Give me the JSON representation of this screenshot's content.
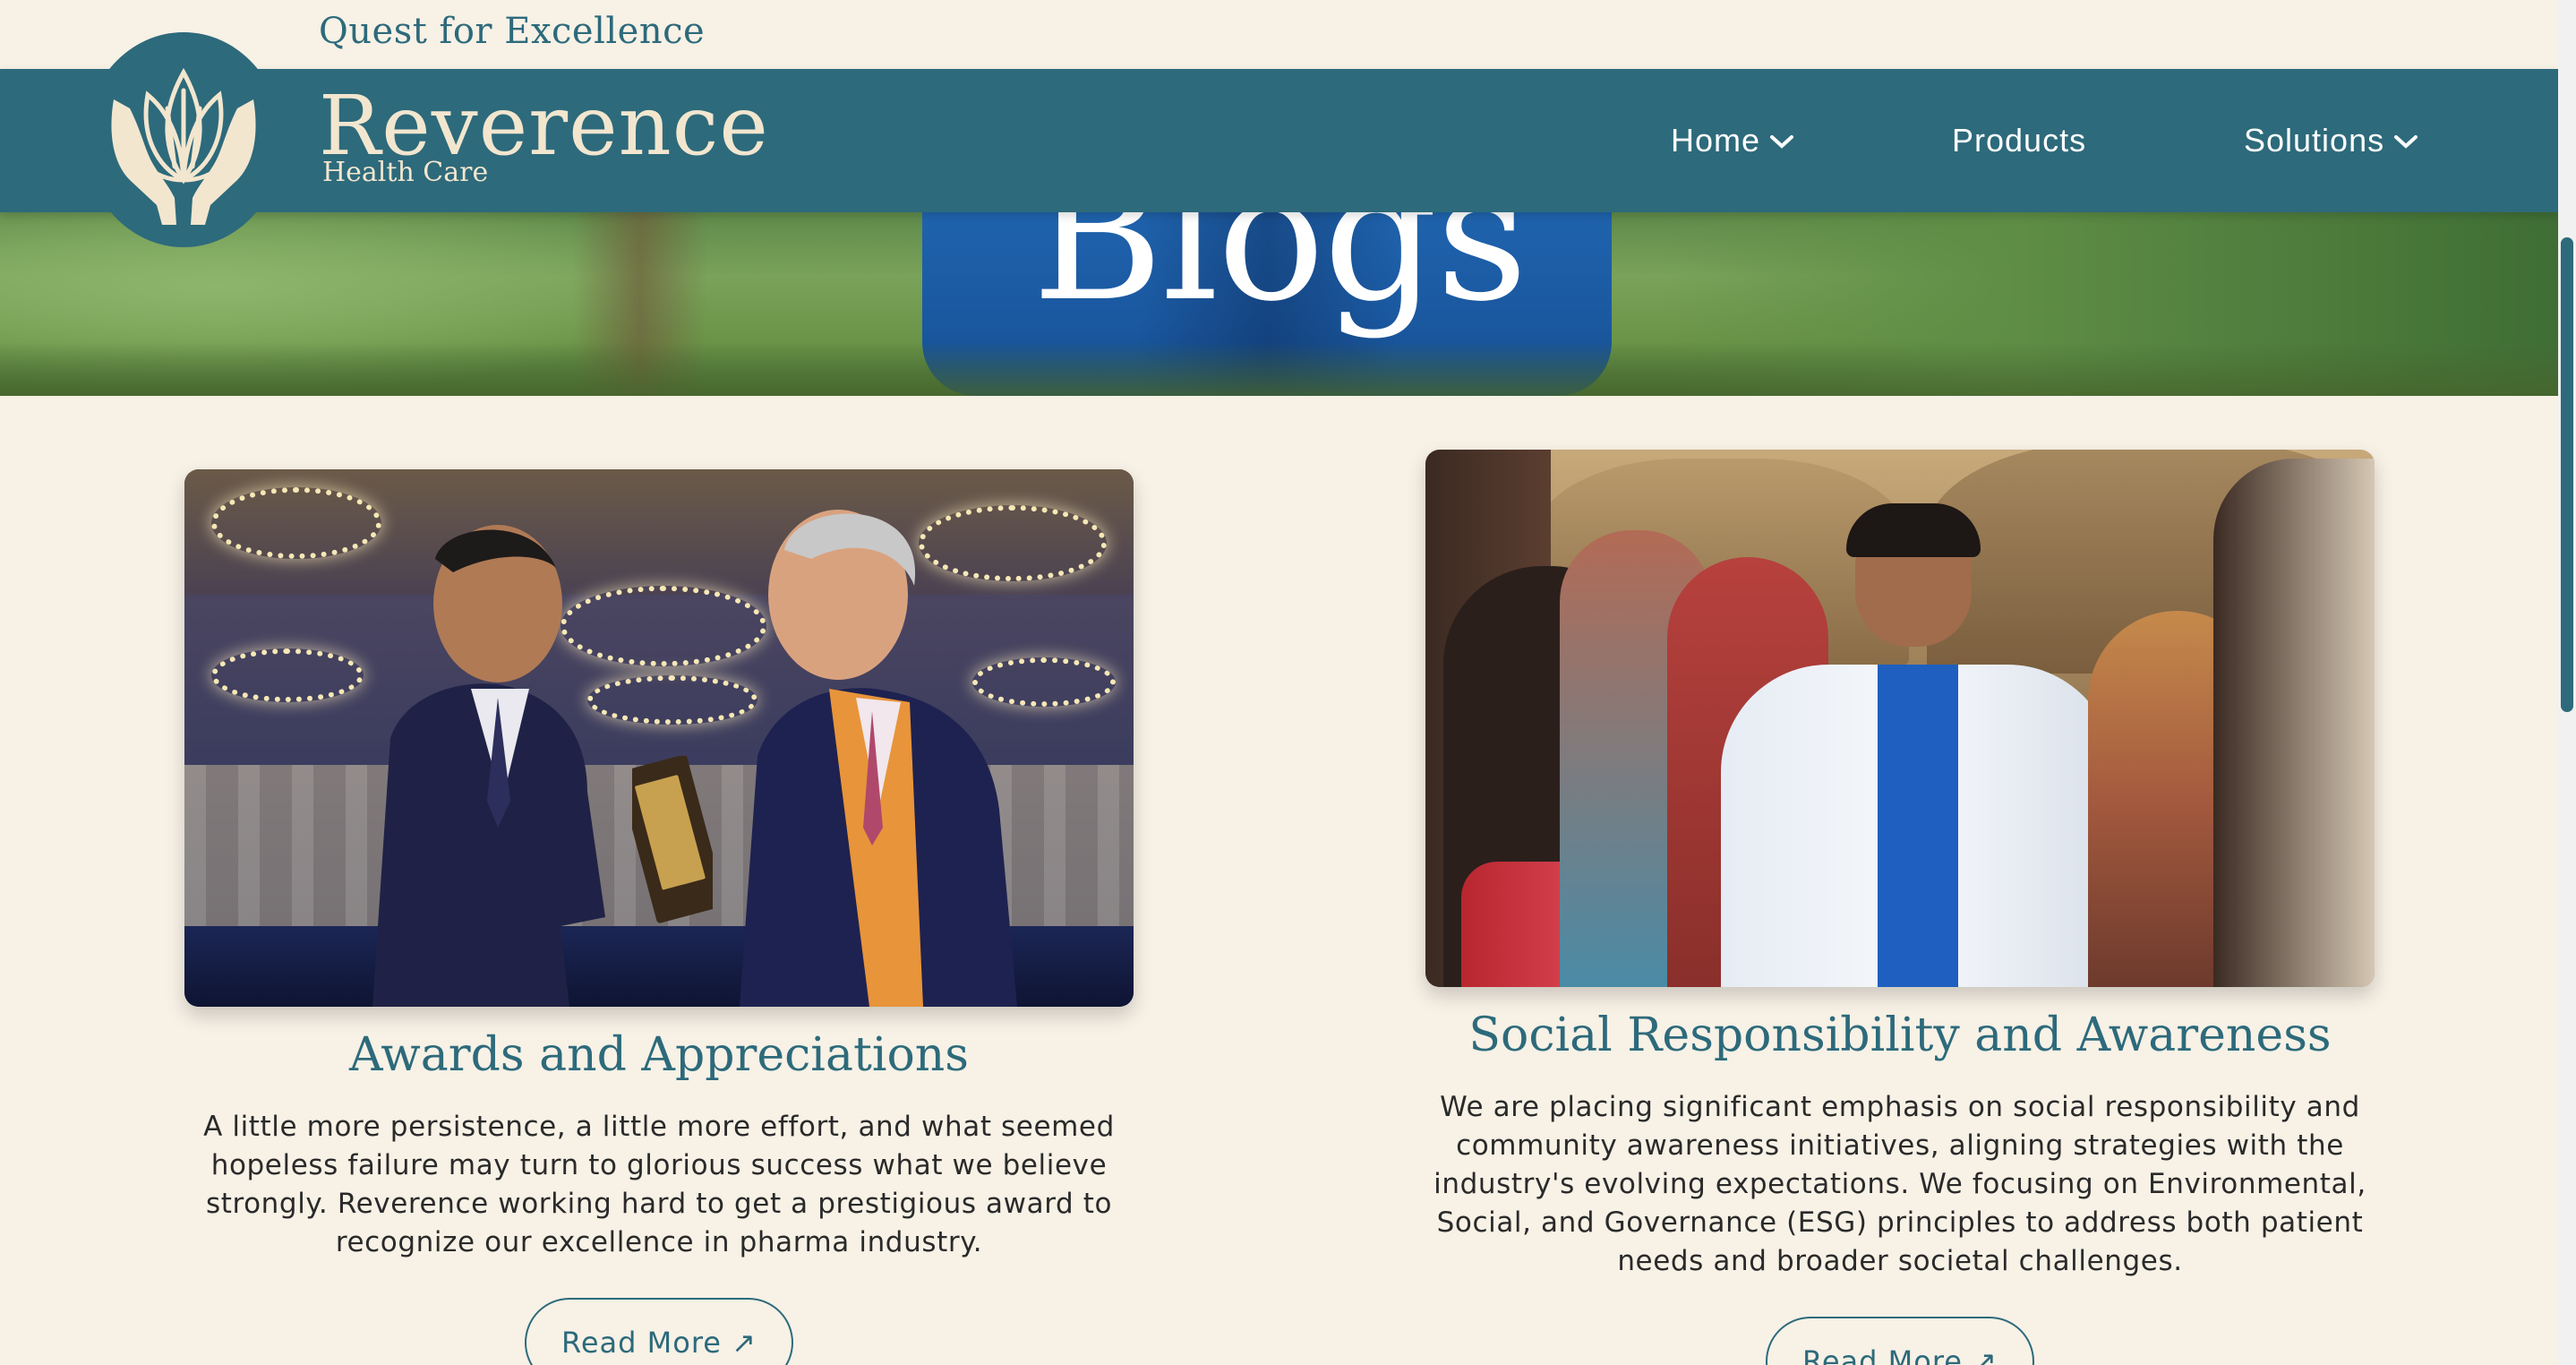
{
  "site": {
    "tagline": "Quest for Excellence",
    "brand_name": "Reverence",
    "brand_sub": "Health Care"
  },
  "nav": {
    "items": [
      {
        "label": "Home",
        "has_dropdown": true
      },
      {
        "label": "Products",
        "has_dropdown": false
      },
      {
        "label": "Solutions",
        "has_dropdown": true
      }
    ]
  },
  "hero": {
    "title": "Blogs"
  },
  "blogs": [
    {
      "title": "Awards and Appreciations",
      "body": "A little more persistence, a little more effort, and what seemed hopeless failure may turn to glorious success what we believe strongly. Reverence working hard to get a prestigious award to recognize our excellence in pharma industry.",
      "button": "Read More ↗"
    },
    {
      "title": "Social Responsibility and Awareness",
      "body": "We are placing significant emphasis on social responsibility and community awareness initiatives, aligning strategies with the industry's evolving expectations. We focusing on Environmental, Social, and Governance (ESG) principles to address both patient needs and broader societal challenges.",
      "button": "Read More ↗"
    }
  ],
  "colors": {
    "brand_teal": "#2d6a7b",
    "background_cream": "#f7f1e6",
    "logo_cream": "#f2e6cf"
  },
  "icons": {
    "logo": "lotus-hands-logo-icon",
    "dropdown": "chevron-down-icon",
    "external": "arrow-up-right-icon"
  }
}
